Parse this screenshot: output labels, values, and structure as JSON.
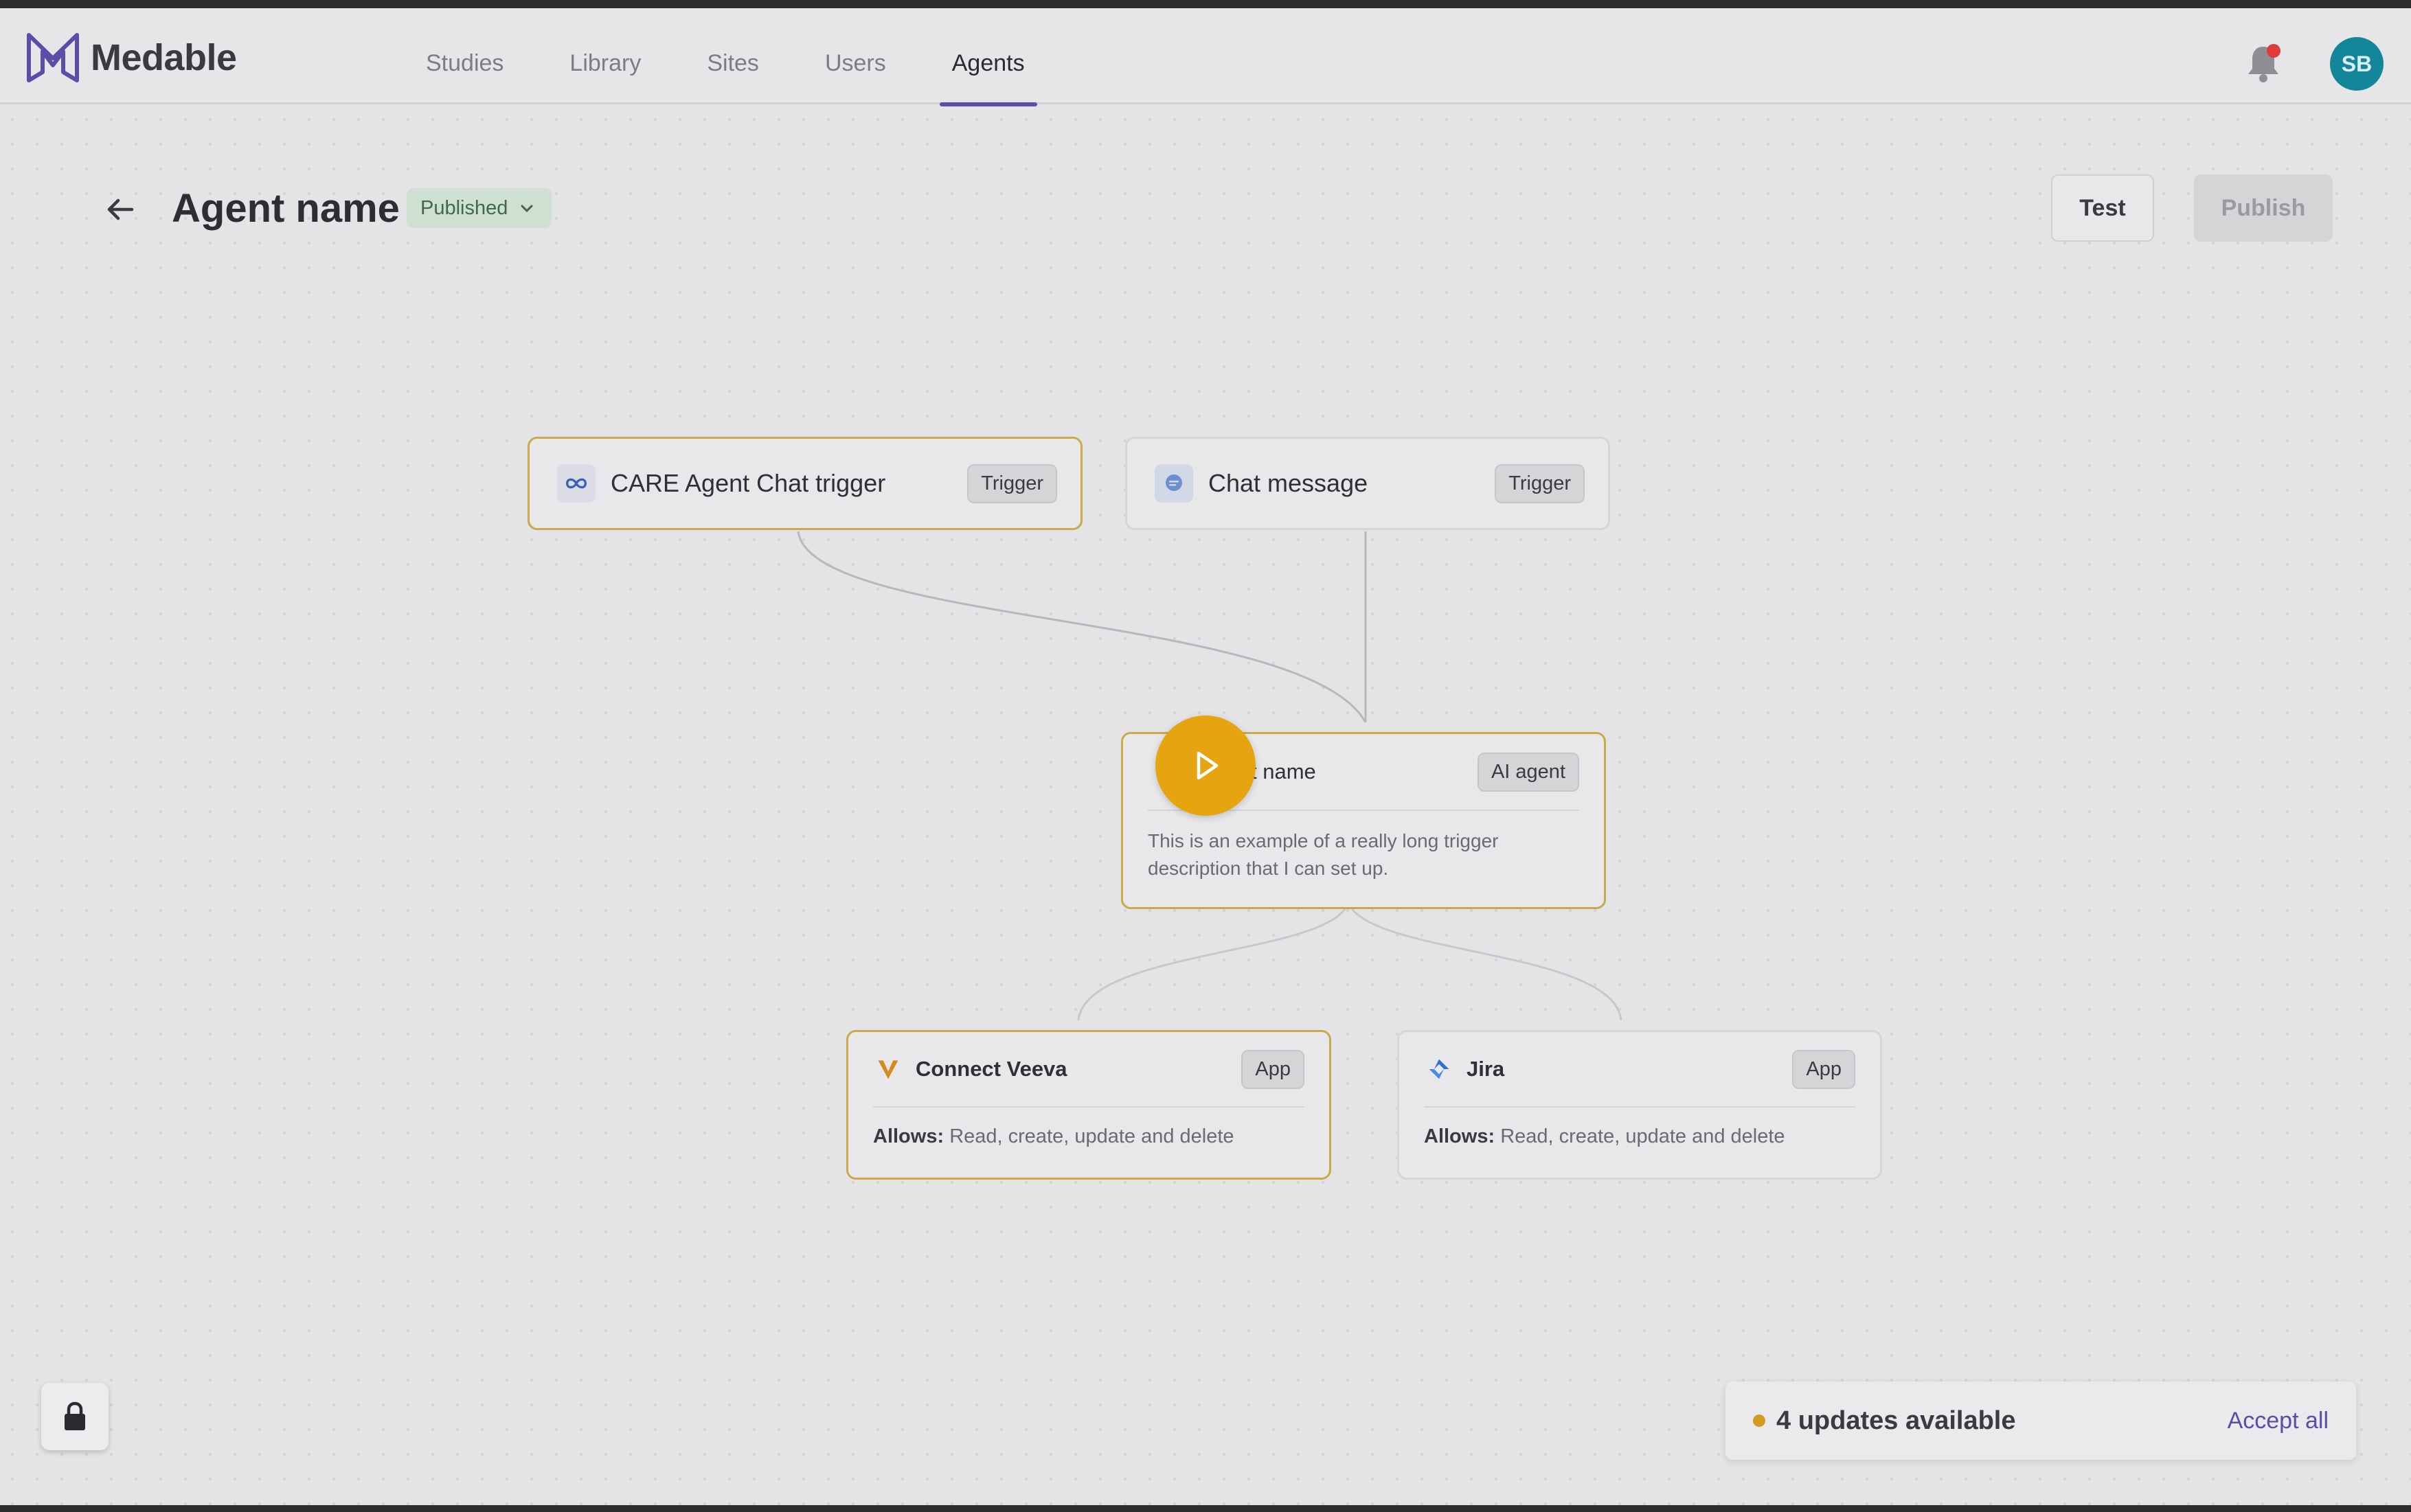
{
  "app": {
    "brand": "Medable",
    "user_initials": "SB"
  },
  "nav": {
    "items": [
      {
        "label": "Studies"
      },
      {
        "label": "Library"
      },
      {
        "label": "Sites"
      },
      {
        "label": "Users"
      },
      {
        "label": "Agents",
        "active": true
      }
    ]
  },
  "header": {
    "title": "Agent name",
    "status": "Published",
    "test_label": "Test",
    "publish_label": "Publish"
  },
  "canvas": {
    "triggers": [
      {
        "title": "CARE Agent Chat trigger",
        "tag": "Trigger",
        "icon": "meta-infinity-icon",
        "selected": true
      },
      {
        "title": "Chat message",
        "tag": "Trigger",
        "icon": "chat-bubble-icon",
        "selected": false
      }
    ],
    "agent": {
      "title": "t name",
      "tag": "AI agent",
      "description": "This is an example of a really long trigger description that I can set up.",
      "selected": true
    },
    "apps": [
      {
        "title": "Connect Veeva",
        "tag": "App",
        "allows_label": "Allows:",
        "allows": "Read, create, update and delete",
        "icon": "veeva-icon",
        "selected": true
      },
      {
        "title": "Jira",
        "tag": "App",
        "allows_label": "Allows:",
        "allows": "Read, create, update and delete",
        "icon": "jira-icon",
        "selected": false
      }
    ]
  },
  "updates": {
    "text": "4 updates available",
    "action": "Accept all"
  },
  "colors": {
    "accent": "#5b4ea8",
    "play": "#e5a410",
    "selected_border": "#c9a94a",
    "avatar": "#14869a"
  }
}
